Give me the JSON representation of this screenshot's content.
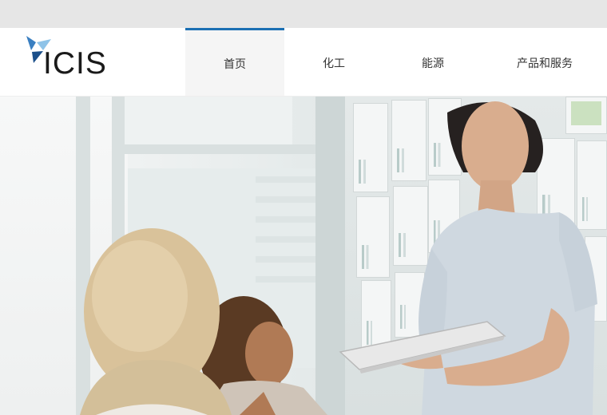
{
  "brand": {
    "name": "ICIS",
    "colors": {
      "dark_blue": "#1b4f8a",
      "mid_blue": "#3a7fc1",
      "light_blue": "#8ec3e8"
    }
  },
  "nav": {
    "items": [
      {
        "label": "首页",
        "active": true
      },
      {
        "label": "化工",
        "active": false
      },
      {
        "label": "能源",
        "active": false
      },
      {
        "label": "产品和服务",
        "active": false
      }
    ],
    "active_color": "#1b6fb3"
  },
  "hero": {
    "description_icon": "hero-photo",
    "theme_colors": {
      "shirt": "#cfd8e0",
      "tablet": "#e8e8e8"
    }
  }
}
